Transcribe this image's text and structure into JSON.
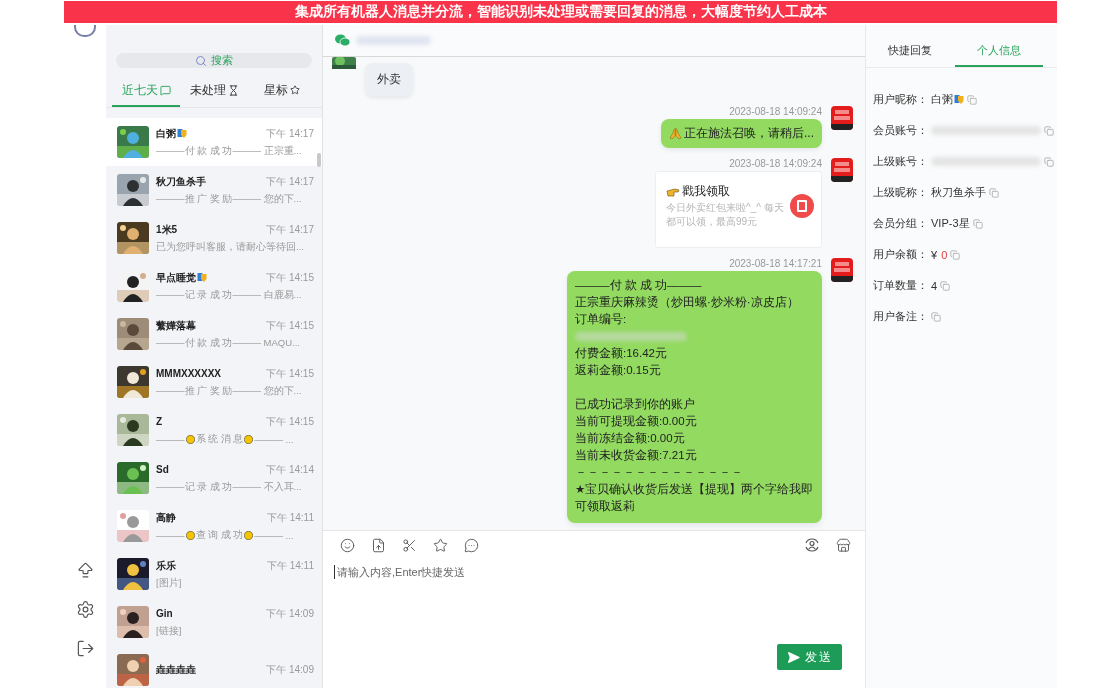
{
  "banner": {
    "text": "集成所有机器人消息并分流，智能识别未处理或需要回复的消息，大幅度节约人工成本"
  },
  "conversations": {
    "search": {
      "placeholder": "搜索"
    },
    "tabs": [
      {
        "label": "近七天",
        "selected": true
      },
      {
        "label": "未处理",
        "selected": false
      },
      {
        "label": "星标",
        "selected": false
      }
    ],
    "items": [
      {
        "name": "白粥",
        "badge": true,
        "time": "下午 14:17",
        "kind": "plain",
        "preview": "———付 款 成 功——— 正宗重...",
        "selected": true
      },
      {
        "name": "秋刀鱼杀手",
        "badge": false,
        "time": "下午 14:17",
        "kind": "plain",
        "preview": "———推 广 奖 励——— 您的下...",
        "selected": false
      },
      {
        "name": "1米5",
        "badge": false,
        "time": "下午 14:17",
        "kind": "plain",
        "preview": "已为您呼叫客服，请耐心等待回...",
        "selected": false
      },
      {
        "name": "早点睡觉",
        "badge": true,
        "time": "下午 14:15",
        "kind": "plain",
        "preview": "———记 录 成 功——— 白鹿易...",
        "selected": false
      },
      {
        "name": "蘩嬅落幕",
        "badge": false,
        "time": "下午 14:15",
        "kind": "plain",
        "preview": "———付 款 成 功——— MAQU...",
        "selected": false
      },
      {
        "name": "MMMXXXXXX",
        "badge": false,
        "time": "下午 14:15",
        "kind": "plain",
        "preview": "———推 广 奖 励——— 您的下...",
        "selected": false
      },
      {
        "name": "Z",
        "badge": false,
        "time": "下午 14:15",
        "kind": "system",
        "preview": [
          "———",
          "系 统 消 息",
          "——— ..."
        ],
        "selected": false
      },
      {
        "name": "Sd",
        "badge": false,
        "time": "下午 14:14",
        "kind": "plain",
        "preview": "———记 录 成 功——— 不入耳...",
        "selected": false
      },
      {
        "name": "高静",
        "badge": false,
        "time": "下午 14:11",
        "kind": "system",
        "preview": [
          "———",
          "查 询 成 功",
          "——— ..."
        ],
        "selected": false
      },
      {
        "name": "乐乐",
        "badge": false,
        "time": "下午 14:11",
        "kind": "plain",
        "preview": "[图片]",
        "selected": false
      },
      {
        "name": "Gin",
        "badge": false,
        "time": "下午 14:09",
        "kind": "plain",
        "preview": "[链接]",
        "selected": false
      },
      {
        "name": "垚垚垚垚",
        "badge": false,
        "time": "下午 14:09",
        "kind": "plain",
        "selected": false
      }
    ]
  },
  "chat": {
    "messages": [
      {
        "kind": "text",
        "outgoing": false,
        "text": "外卖"
      },
      {
        "kind": "status",
        "outgoing": true,
        "time": "2023-08-18 14:09:24",
        "text": "正在施法召唤，请稍后..."
      },
      {
        "kind": "card",
        "outgoing": true,
        "time": "2023-08-18 14:09:24",
        "title": "戳我领取",
        "desc": "今日外卖红包来啦^_^ 每天都可以领，最高99元"
      },
      {
        "kind": "receipt",
        "outgoing": true,
        "time": "2023-08-18 14:17:21",
        "lines": [
          {
            "kind": "text",
            "text": "———付 款 成 功———"
          },
          {
            "kind": "text",
            "text": "正宗重庆麻辣烫（炒田螺·炒米粉·凉皮店）"
          },
          {
            "kind": "text",
            "text": "订单编号:"
          },
          {
            "kind": "redacted"
          },
          {
            "kind": "text",
            "text": "付费金额:16.42元"
          },
          {
            "kind": "text",
            "text": "返莉金额:0.15元"
          },
          {
            "kind": "gap"
          },
          {
            "kind": "text",
            "text": "已成功记录到你的账户"
          },
          {
            "kind": "text",
            "text": "当前可提现金额:0.00元"
          },
          {
            "kind": "text",
            "text": "当前冻结金额:0.00元"
          },
          {
            "kind": "text",
            "text": "当前未收货金额:7.21元"
          },
          {
            "kind": "text",
            "text": "－－－－－－－－－－－－－－"
          },
          {
            "kind": "text",
            "text": "★宝贝确认收货后发送【提现】两个字给我即可领取返莉"
          }
        ]
      }
    ],
    "input": {
      "placeholder": "请输入内容,Enter快捷发送"
    },
    "send": {
      "label": "发送"
    }
  },
  "profile": {
    "tabs": [
      {
        "label": "快捷回复",
        "selected": false
      },
      {
        "label": "个人信息",
        "selected": true
      }
    ],
    "fields": [
      {
        "label": "用户昵称：",
        "kind": "text",
        "value": "白粥",
        "badge": true
      },
      {
        "label": "会员账号：",
        "kind": "redacted"
      },
      {
        "label": "上级账号：",
        "kind": "redacted"
      },
      {
        "label": "上级昵称：",
        "kind": "text",
        "value": "秋刀鱼杀手",
        "badge": false
      },
      {
        "label": "会员分组：",
        "kind": "text",
        "value": "VIP-3星",
        "badge": false
      },
      {
        "label": "用户余额：",
        "kind": "balance",
        "currency": "¥",
        "value": "0"
      },
      {
        "label": "订单数量：",
        "kind": "text",
        "value": "4",
        "badge": false
      },
      {
        "label": "用户备注：",
        "kind": "empty"
      }
    ]
  }
}
